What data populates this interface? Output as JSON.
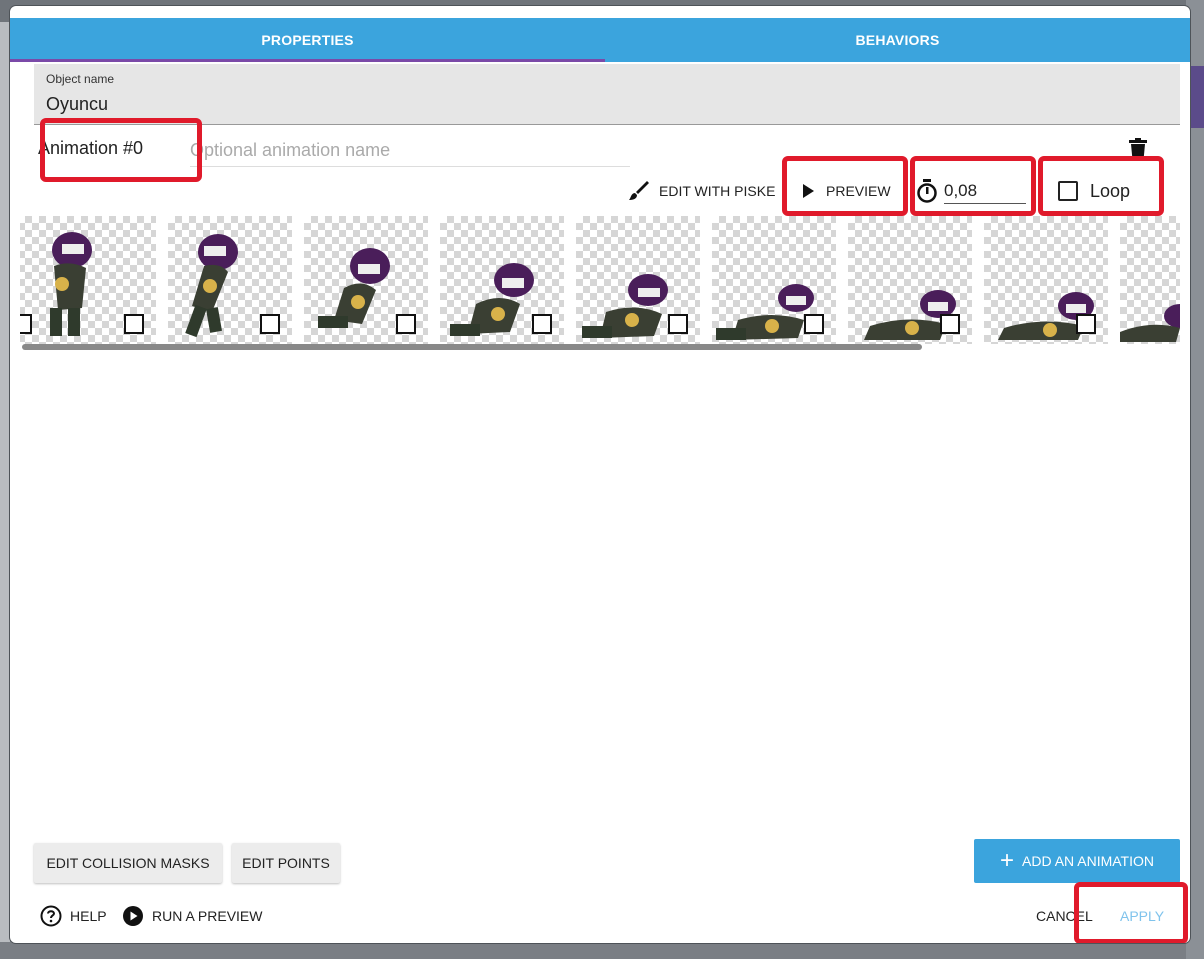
{
  "tabs": {
    "properties": "PROPERTIES",
    "behaviors": "BEHAVIORS"
  },
  "object": {
    "label": "Object name",
    "value": "Oyuncu"
  },
  "animation": {
    "title": "Animation #0",
    "name_placeholder": "Optional animation name"
  },
  "toolbar": {
    "edit_with_piskel": "EDIT WITH PISKE",
    "preview": "PREVIEW",
    "time_between_frames": "0,08",
    "loop_label": "Loop",
    "loop_checked": false
  },
  "frames": {
    "count_visible": 9
  },
  "buttons": {
    "edit_collision_masks": "EDIT COLLISION MASKS",
    "edit_points": "EDIT POINTS",
    "add_animation": "ADD AN ANIMATION"
  },
  "footer": {
    "help": "HELP",
    "run_preview": "RUN A PREVIEW",
    "cancel": "CANCEL",
    "apply": "APPLY"
  },
  "colors": {
    "accent": "#3ba4dd",
    "tab_indicator": "#7b4aa8",
    "highlight": "#e01a2b",
    "ninja_purple": "#4a1e5a"
  }
}
